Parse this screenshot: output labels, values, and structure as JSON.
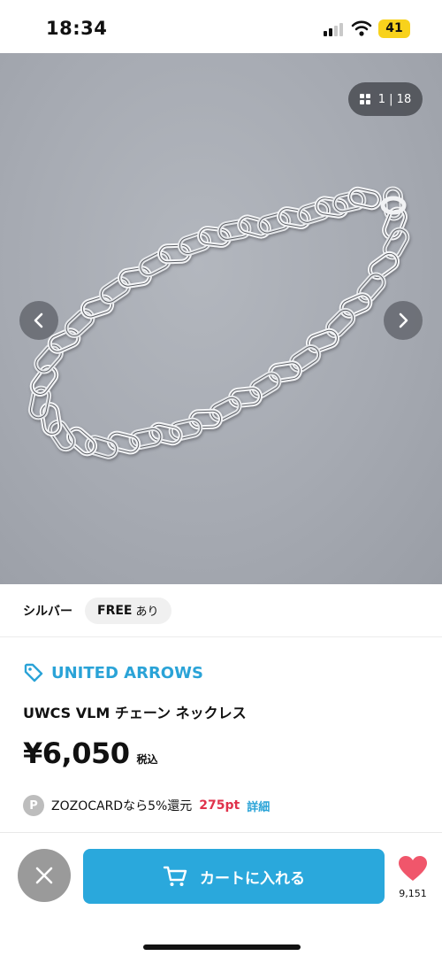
{
  "status": {
    "time": "18:34",
    "battery": "41"
  },
  "gallery": {
    "counter": "1 | 18"
  },
  "variant": {
    "color": "シルバー",
    "size": "FREE",
    "stock": "あり"
  },
  "product": {
    "brand": "UNITED ARROWS",
    "name": "UWCS VLM チェーン ネックレス",
    "price": "¥6,050",
    "tax_label": "税込"
  },
  "points": {
    "badge": "P",
    "text": "ZOZOCARDなら5%還元",
    "amount": "275pt",
    "link": "詳細"
  },
  "bottom_bar": {
    "cart_label": "カートに入れる",
    "favorite_count": "9,151"
  },
  "colors": {
    "accent": "#2aa8dc",
    "brand": "#2aa3d7",
    "points": "#e0324b",
    "favorite": "#f0566b"
  },
  "icons": [
    "grid-icon",
    "chevron-left-icon",
    "chevron-right-icon",
    "tag-icon",
    "close-icon",
    "cart-icon",
    "heart-icon",
    "signal-icon",
    "wifi-icon",
    "battery-icon"
  ]
}
